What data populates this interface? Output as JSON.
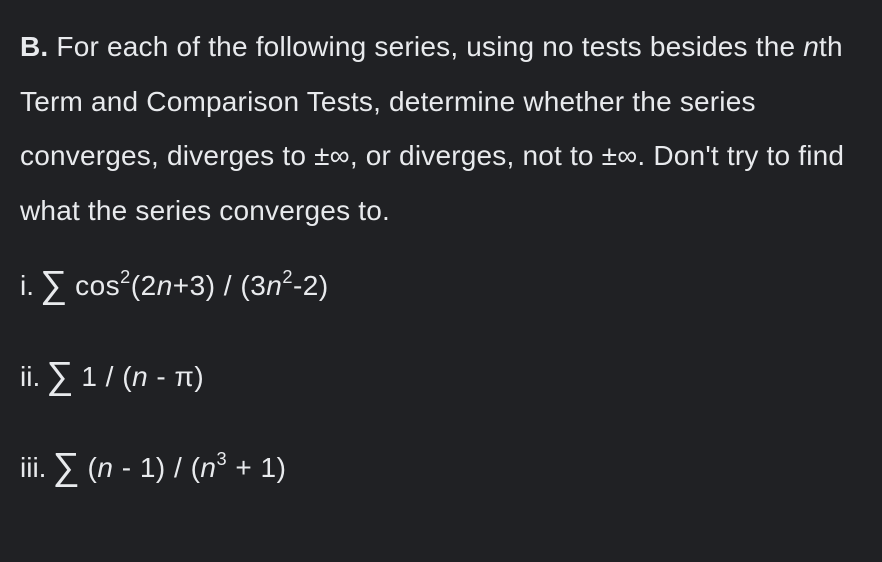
{
  "problem": {
    "label": "B.",
    "intro_part1": " For each of the following series, using no tests besides the ",
    "nth_italic": "n",
    "intro_part2": "th Term and Comparison Tests, determine whether the series converges, diverges to ±∞, or diverges, not to ±∞. Don't try to find what the series converges to."
  },
  "series": {
    "items": [
      {
        "label": "i.",
        "sigma": "∑",
        "expr_parts": {
          "p1": "cos",
          "sup1": "2",
          "p2": "(2",
          "n1": "n",
          "p3": "+3) / (3",
          "n2": "n",
          "sup2": "2",
          "p4": "-2)"
        }
      },
      {
        "label": "ii.",
        "sigma": "∑",
        "expr_parts": {
          "p1": "1 / (",
          "n1": "n",
          "p2": " - π)"
        }
      },
      {
        "label": "iii.",
        "sigma": "∑",
        "expr_parts": {
          "p1": "(",
          "n1": "n",
          "p2": " - 1) / (",
          "n2": "n",
          "sup1": "3",
          "p3": " + 1)"
        }
      }
    ]
  }
}
